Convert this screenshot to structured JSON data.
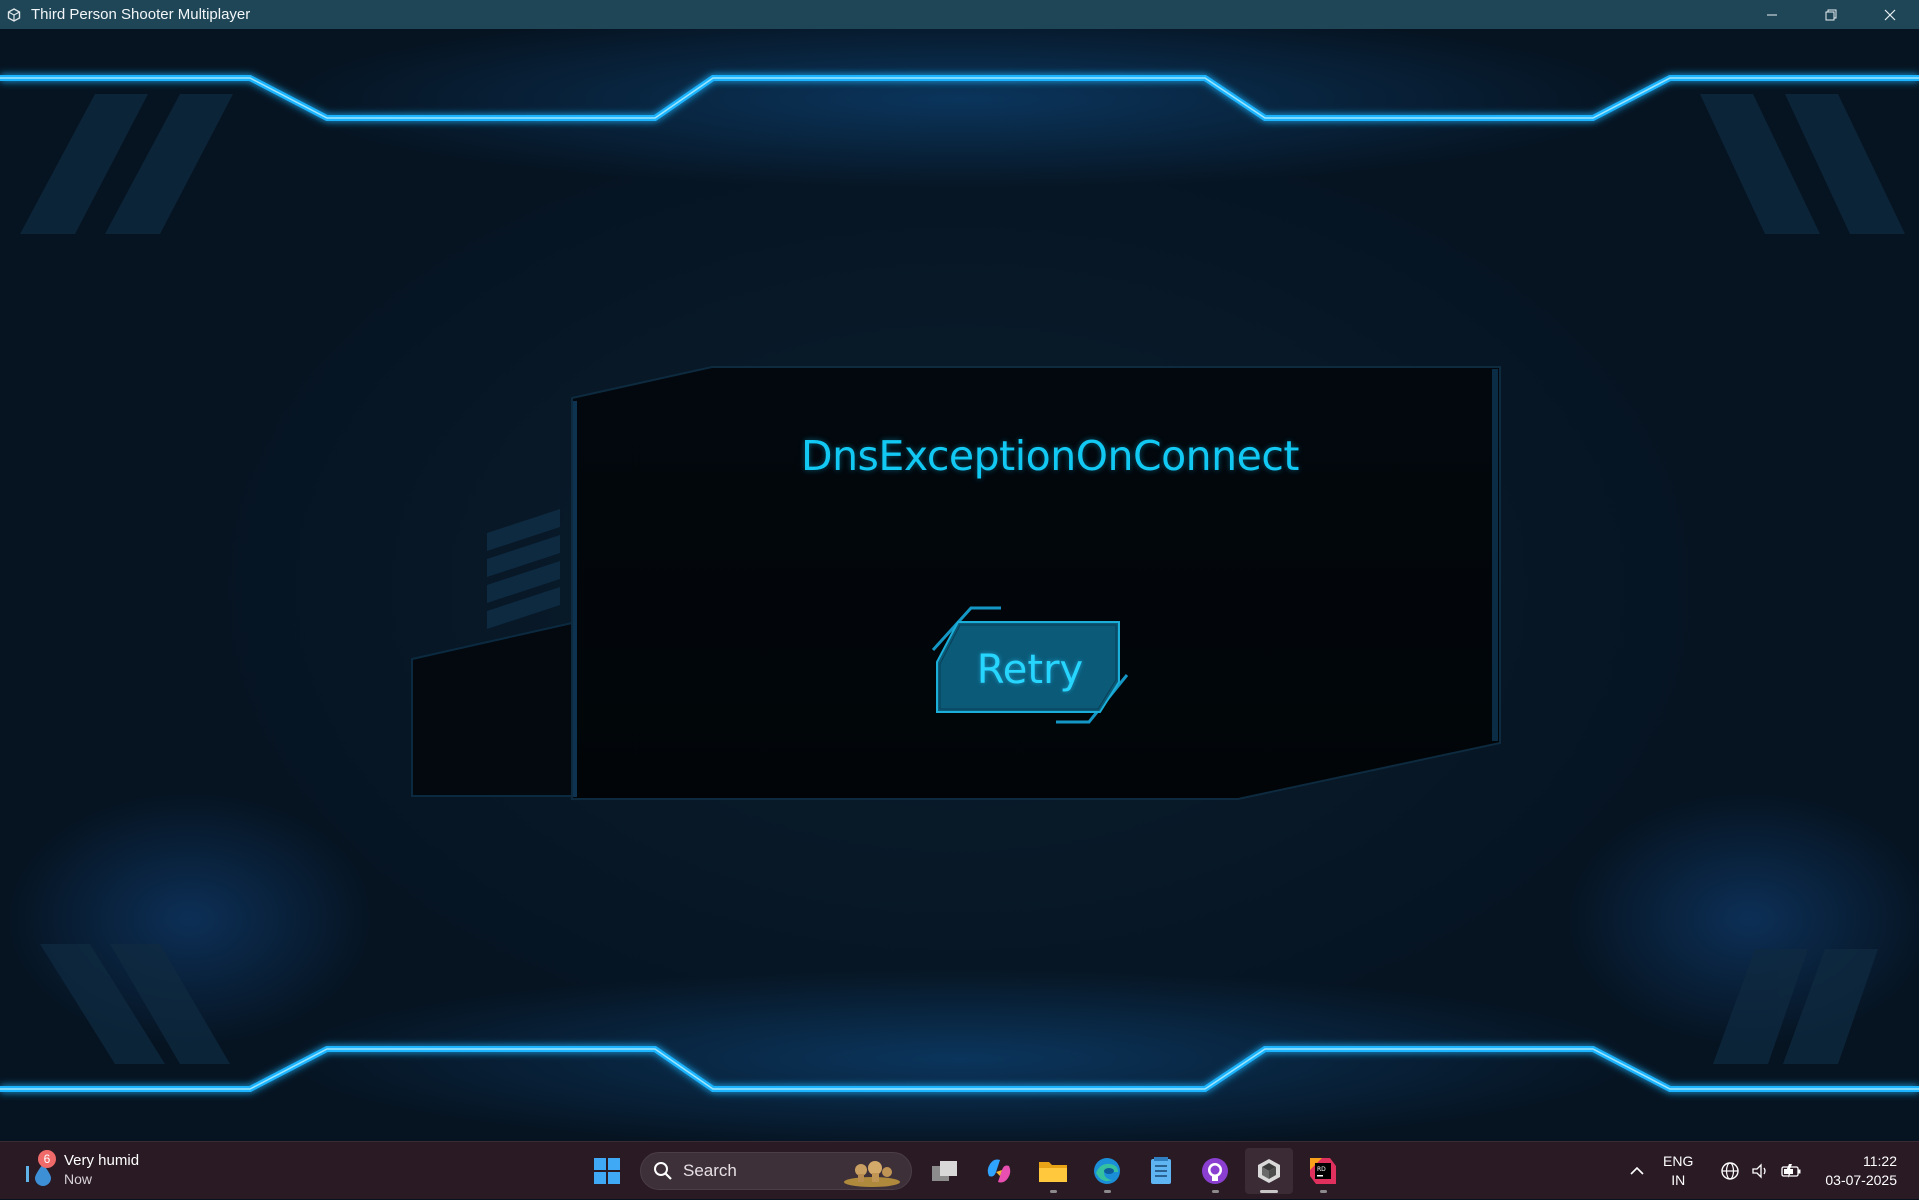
{
  "window": {
    "title": "Third Person Shooter Multiplayer",
    "icon": "unity-icon",
    "controls": [
      "minimize-icon",
      "restore-icon",
      "close-icon"
    ]
  },
  "game": {
    "error_message": "DnsExceptionOnConnect",
    "retry_label": "Retry",
    "accent_color": "#12c9f3",
    "neon_color": "#1aa8ff"
  },
  "taskbar": {
    "weather": {
      "title": "Very humid",
      "subtitle": "Now",
      "badge_count": "6"
    },
    "search_placeholder": "Search",
    "apps": [
      {
        "name": "windows-start-icon"
      },
      {
        "name": "task-view-icon"
      },
      {
        "name": "copilot-icon"
      },
      {
        "name": "file-explorer-icon"
      },
      {
        "name": "edge-icon"
      },
      {
        "name": "notepad-icon"
      },
      {
        "name": "github-desktop-icon"
      },
      {
        "name": "unity-icon"
      },
      {
        "name": "rider-icon"
      }
    ],
    "language": {
      "line1": "ENG",
      "line2": "IN"
    },
    "clock": {
      "time": "11:22",
      "date": "03-07-2025"
    }
  }
}
